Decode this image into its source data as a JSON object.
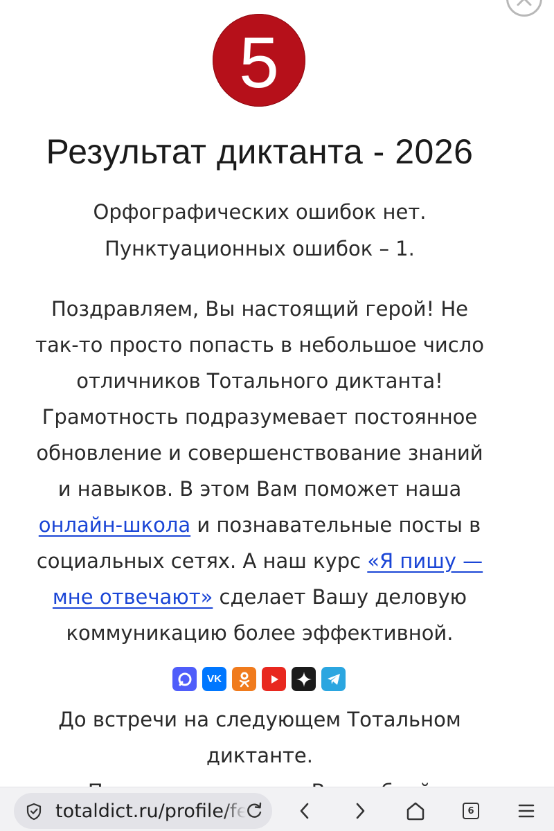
{
  "grade": "5",
  "title": "Результат диктанта - 2026",
  "summary": {
    "line1": "Орфографических ошибок нет.",
    "line2": "Пунктуационных ошибок – 1."
  },
  "congrats": {
    "line1": "Поздравляем, Вы настоящий герой! Не",
    "line2": "так-то просто попасть в небольшое число",
    "line3": "отличников Тотального диктанта!",
    "line4": "Грамотность подразумевает постоянное",
    "line5": "обновление и совершенствование знаний",
    "line6": "и навыков. В этом Вам поможет наша",
    "link_school": "онлайн-школа",
    "line7_rest": " и познавательные посты в",
    "line8_start": "социальных сетях. А наш курс ",
    "link_course_part1": "«Я пишу —",
    "link_course_part2": "мне отвечают»",
    "line9_rest": " сделает Вашу деловую",
    "line10": "коммуникацию более эффективной."
  },
  "social": [
    {
      "name": "max-icon",
      "color": "#4f5dfa"
    },
    {
      "name": "vk-icon",
      "label": "VK",
      "color": "#0077ff"
    },
    {
      "name": "odnoklassniki-icon",
      "color": "#f07b1d"
    },
    {
      "name": "youtube-icon",
      "color": "#e8281f"
    },
    {
      "name": "dzen-icon",
      "color": "#1b1b1b"
    },
    {
      "name": "telegram-icon",
      "color": "#2ba6e0"
    }
  ],
  "farewell": {
    "line1": "До встречи на следующем Тотальном",
    "line2": "диктанте.",
    "line3": "Пусть он станет для Вас доброй"
  },
  "browser": {
    "url": "totaldict.ru/profile/fe",
    "tabs_count": "6"
  },
  "colors": {
    "grade_circle": "#b6101a",
    "link": "#1a45d6"
  }
}
